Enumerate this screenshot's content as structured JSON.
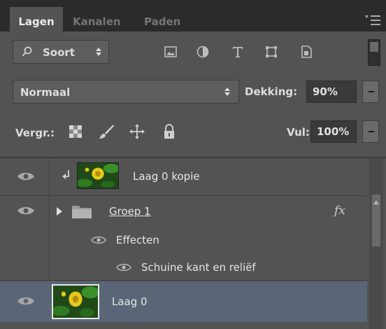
{
  "tabs": [
    {
      "label": "Lagen",
      "active": true
    },
    {
      "label": "Kanalen",
      "active": false
    },
    {
      "label": "Paden",
      "active": false
    }
  ],
  "filter": {
    "label": "Soort",
    "icons": [
      "image-filter-icon",
      "adjustment-filter-icon",
      "type-filter-icon",
      "shape-filter-icon",
      "smart-object-filter-icon"
    ]
  },
  "blend": {
    "mode": "Normaal",
    "opacity_label": "Dekking:",
    "opacity_value": "90%"
  },
  "lock": {
    "label": "Vergr.:",
    "icons": [
      "lock-transparent-icon",
      "lock-paint-icon",
      "lock-position-icon",
      "lock-all-icon"
    ],
    "fill_label": "Vul:",
    "fill_value": "100%"
  },
  "layers": [
    {
      "name": "Laag 0 kopie",
      "type": "clipped-layer",
      "visible": true
    },
    {
      "name": "Groep 1",
      "type": "group",
      "visible": true,
      "fx": "fx"
    },
    {
      "name": "Effecten",
      "type": "effects",
      "visible": true
    },
    {
      "name": "Schuine kant en reliëf",
      "type": "effect",
      "visible": true
    },
    {
      "name": "Laag 0",
      "type": "layer",
      "visible": true,
      "selected": true
    }
  ],
  "colors": {
    "panel": "#535353",
    "tabbar": "#2b2b2b",
    "selected_row": "#5a6678"
  }
}
